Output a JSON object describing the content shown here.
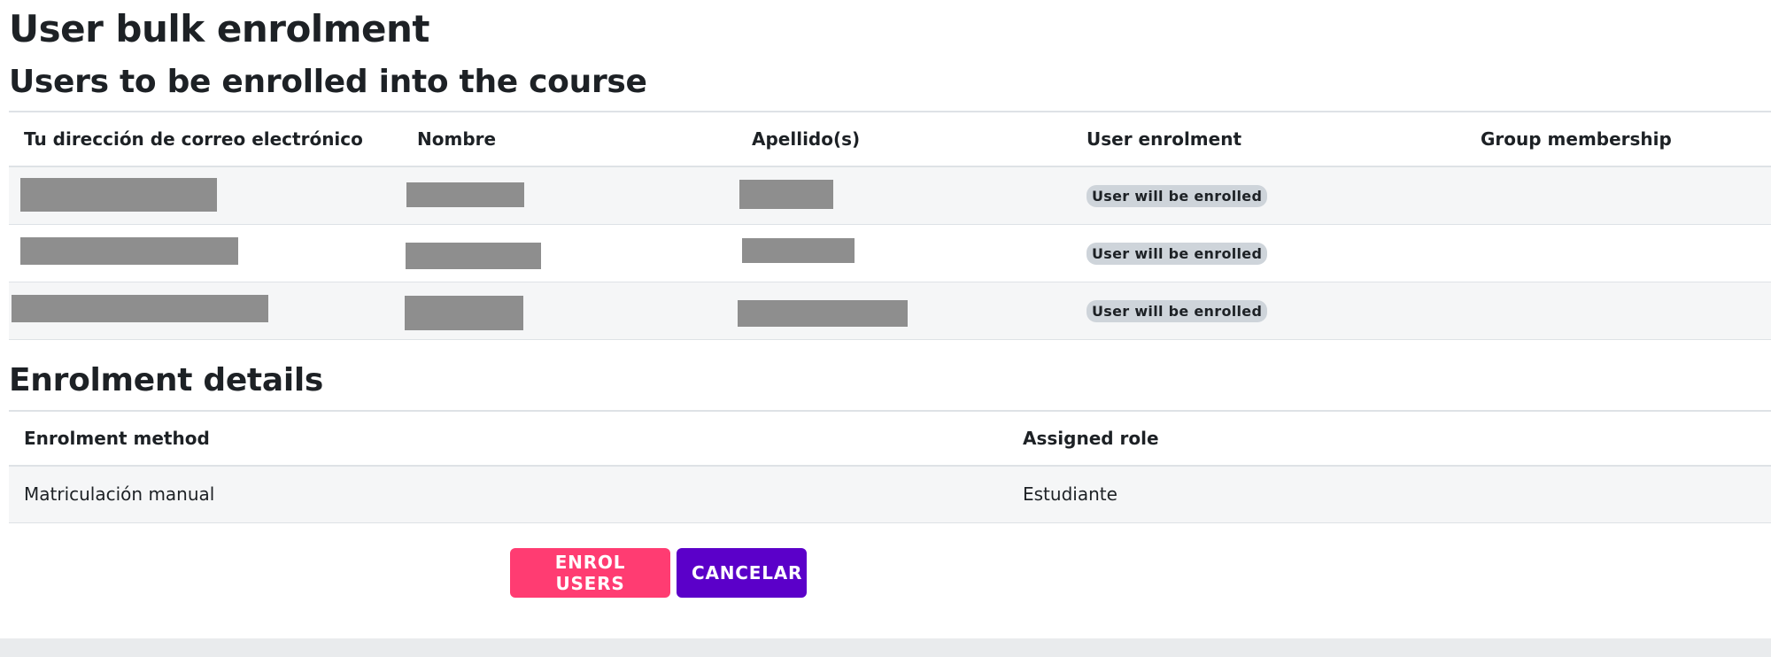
{
  "page": {
    "title": "User bulk enrolment",
    "users_section_title": "Users to be enrolled into the course",
    "details_section_title": "Enrolment details"
  },
  "users_table": {
    "columns": [
      "Tu dirección de correo electrónico",
      "Nombre",
      "Apellido(s)",
      "User enrolment",
      "Group membership"
    ],
    "rows": [
      {
        "email": "",
        "first_name": "",
        "last_name": "",
        "enrolment_status": "User will be enrolled",
        "group_membership": ""
      },
      {
        "email": "",
        "first_name": "",
        "last_name": "",
        "enrolment_status": "User will be enrolled",
        "group_membership": ""
      },
      {
        "email": "",
        "first_name": "",
        "last_name": "",
        "enrolment_status": "User will be enrolled",
        "group_membership": ""
      }
    ]
  },
  "details_table": {
    "columns": [
      "Enrolment method",
      "Assigned role"
    ],
    "rows": [
      {
        "method": "Matriculación manual",
        "role": "Estudiante"
      }
    ]
  },
  "actions": {
    "enrol_label": "ENROL USERS",
    "cancel_label": "CANCELAR"
  },
  "colors": {
    "enrol_button": "#ff3c72",
    "cancel_button": "#5b00c9",
    "badge_background": "#ced4da",
    "redaction": "#8e8e8e"
  }
}
